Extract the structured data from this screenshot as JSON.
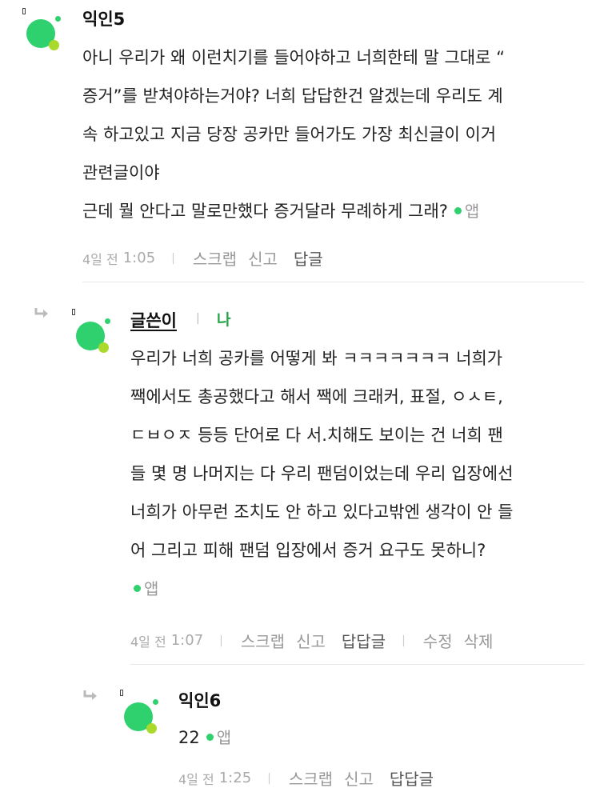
{
  "comments": [
    {
      "author": "익인5",
      "lines": [
        "아니 우리가 왜 이런치기를 들어야하고 너희한테 말 그대로 “",
        "증거”를 받쳐야하는거야? 너희 답답한건 알겠는데 우리도 계",
        "속 하고있고 지금 당장 공카만 들어가도 가장 최신글이 이거",
        "관련글이야",
        "근데 뭘 안다고 말로만했다 증거달라 무례하게 그래?"
      ],
      "app_label": "앱",
      "date": "4일 전",
      "time": "1:05",
      "actions": [
        "스크랩",
        "신고",
        "답글"
      ]
    },
    {
      "author": "글쓴이",
      "me_badge": "나",
      "lines": [
        "우리가 너희 공카를 어떻게 봐 ㅋㅋㅋㅋㅋㅋㅋ 너희가",
        "짹에서도 총공했다고 해서 짹에 크래커, 표절, ㅇㅅㅌ,",
        "ㄷㅂㅇㅈ 등등 단어로 다 서.치해도 보이는 건 너희 팬",
        "들 몇 명 나머지는 다 우리 팬덤이었는데 우리 입장에선",
        "너희가 아무런 조치도 안 하고 있다고밖엔 생각이 안 들",
        "어 그리고 피해 팬덤 입장에서 증거 요구도 못하니?"
      ],
      "app_label": "앱",
      "date": "4일 전",
      "time": "1:07",
      "actions": [
        "스크랩",
        "신고",
        "답답글"
      ],
      "owner_actions": [
        "수정",
        "삭제"
      ]
    },
    {
      "author": "익인6",
      "lines": [
        "22"
      ],
      "app_label": "앱",
      "date": "4일 전",
      "time": "1:25",
      "actions": [
        "스크랩",
        "신고",
        "답답글"
      ]
    }
  ]
}
